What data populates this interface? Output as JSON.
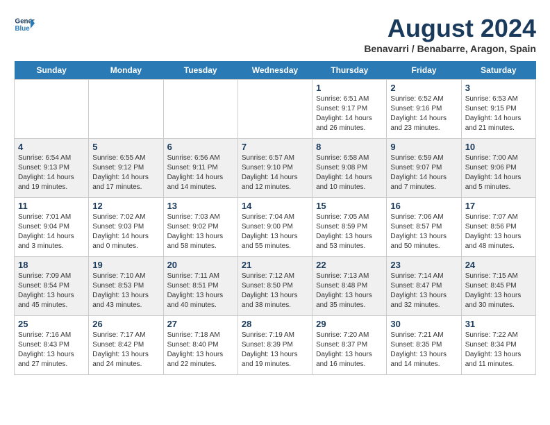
{
  "header": {
    "logo_line1": "General",
    "logo_line2": "Blue",
    "month": "August 2024",
    "location": "Benavarri / Benabarre, Aragon, Spain"
  },
  "days_of_week": [
    "Sunday",
    "Monday",
    "Tuesday",
    "Wednesday",
    "Thursday",
    "Friday",
    "Saturday"
  ],
  "weeks": [
    [
      {
        "day": "",
        "info": ""
      },
      {
        "day": "",
        "info": ""
      },
      {
        "day": "",
        "info": ""
      },
      {
        "day": "",
        "info": ""
      },
      {
        "day": "1",
        "info": "Sunrise: 6:51 AM\nSunset: 9:17 PM\nDaylight: 14 hours\nand 26 minutes."
      },
      {
        "day": "2",
        "info": "Sunrise: 6:52 AM\nSunset: 9:16 PM\nDaylight: 14 hours\nand 23 minutes."
      },
      {
        "day": "3",
        "info": "Sunrise: 6:53 AM\nSunset: 9:15 PM\nDaylight: 14 hours\nand 21 minutes."
      }
    ],
    [
      {
        "day": "4",
        "info": "Sunrise: 6:54 AM\nSunset: 9:13 PM\nDaylight: 14 hours\nand 19 minutes."
      },
      {
        "day": "5",
        "info": "Sunrise: 6:55 AM\nSunset: 9:12 PM\nDaylight: 14 hours\nand 17 minutes."
      },
      {
        "day": "6",
        "info": "Sunrise: 6:56 AM\nSunset: 9:11 PM\nDaylight: 14 hours\nand 14 minutes."
      },
      {
        "day": "7",
        "info": "Sunrise: 6:57 AM\nSunset: 9:10 PM\nDaylight: 14 hours\nand 12 minutes."
      },
      {
        "day": "8",
        "info": "Sunrise: 6:58 AM\nSunset: 9:08 PM\nDaylight: 14 hours\nand 10 minutes."
      },
      {
        "day": "9",
        "info": "Sunrise: 6:59 AM\nSunset: 9:07 PM\nDaylight: 14 hours\nand 7 minutes."
      },
      {
        "day": "10",
        "info": "Sunrise: 7:00 AM\nSunset: 9:06 PM\nDaylight: 14 hours\nand 5 minutes."
      }
    ],
    [
      {
        "day": "11",
        "info": "Sunrise: 7:01 AM\nSunset: 9:04 PM\nDaylight: 14 hours\nand 3 minutes."
      },
      {
        "day": "12",
        "info": "Sunrise: 7:02 AM\nSunset: 9:03 PM\nDaylight: 14 hours\nand 0 minutes."
      },
      {
        "day": "13",
        "info": "Sunrise: 7:03 AM\nSunset: 9:02 PM\nDaylight: 13 hours\nand 58 minutes."
      },
      {
        "day": "14",
        "info": "Sunrise: 7:04 AM\nSunset: 9:00 PM\nDaylight: 13 hours\nand 55 minutes."
      },
      {
        "day": "15",
        "info": "Sunrise: 7:05 AM\nSunset: 8:59 PM\nDaylight: 13 hours\nand 53 minutes."
      },
      {
        "day": "16",
        "info": "Sunrise: 7:06 AM\nSunset: 8:57 PM\nDaylight: 13 hours\nand 50 minutes."
      },
      {
        "day": "17",
        "info": "Sunrise: 7:07 AM\nSunset: 8:56 PM\nDaylight: 13 hours\nand 48 minutes."
      }
    ],
    [
      {
        "day": "18",
        "info": "Sunrise: 7:09 AM\nSunset: 8:54 PM\nDaylight: 13 hours\nand 45 minutes."
      },
      {
        "day": "19",
        "info": "Sunrise: 7:10 AM\nSunset: 8:53 PM\nDaylight: 13 hours\nand 43 minutes."
      },
      {
        "day": "20",
        "info": "Sunrise: 7:11 AM\nSunset: 8:51 PM\nDaylight: 13 hours\nand 40 minutes."
      },
      {
        "day": "21",
        "info": "Sunrise: 7:12 AM\nSunset: 8:50 PM\nDaylight: 13 hours\nand 38 minutes."
      },
      {
        "day": "22",
        "info": "Sunrise: 7:13 AM\nSunset: 8:48 PM\nDaylight: 13 hours\nand 35 minutes."
      },
      {
        "day": "23",
        "info": "Sunrise: 7:14 AM\nSunset: 8:47 PM\nDaylight: 13 hours\nand 32 minutes."
      },
      {
        "day": "24",
        "info": "Sunrise: 7:15 AM\nSunset: 8:45 PM\nDaylight: 13 hours\nand 30 minutes."
      }
    ],
    [
      {
        "day": "25",
        "info": "Sunrise: 7:16 AM\nSunset: 8:43 PM\nDaylight: 13 hours\nand 27 minutes."
      },
      {
        "day": "26",
        "info": "Sunrise: 7:17 AM\nSunset: 8:42 PM\nDaylight: 13 hours\nand 24 minutes."
      },
      {
        "day": "27",
        "info": "Sunrise: 7:18 AM\nSunset: 8:40 PM\nDaylight: 13 hours\nand 22 minutes."
      },
      {
        "day": "28",
        "info": "Sunrise: 7:19 AM\nSunset: 8:39 PM\nDaylight: 13 hours\nand 19 minutes."
      },
      {
        "day": "29",
        "info": "Sunrise: 7:20 AM\nSunset: 8:37 PM\nDaylight: 13 hours\nand 16 minutes."
      },
      {
        "day": "30",
        "info": "Sunrise: 7:21 AM\nSunset: 8:35 PM\nDaylight: 13 hours\nand 14 minutes."
      },
      {
        "day": "31",
        "info": "Sunrise: 7:22 AM\nSunset: 8:34 PM\nDaylight: 13 hours\nand 11 minutes."
      }
    ]
  ]
}
